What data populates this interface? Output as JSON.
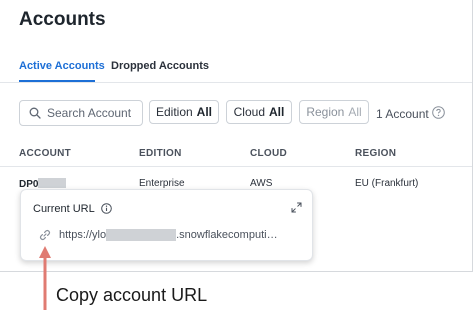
{
  "page": {
    "title": "Accounts"
  },
  "tabs": [
    {
      "label": "Active Accounts",
      "active": true
    },
    {
      "label": "Dropped Accounts",
      "active": false
    }
  ],
  "toolbar": {
    "search_placeholder": "Search Account",
    "filters": [
      {
        "label": "Edition",
        "value": "All",
        "enabled": true
      },
      {
        "label": "Cloud",
        "value": "All",
        "enabled": true
      },
      {
        "label": "Region",
        "value": "All",
        "enabled": false
      }
    ],
    "count": "1 Account"
  },
  "table": {
    "columns": [
      "ACCOUNT",
      "EDITION",
      "CLOUD",
      "REGION"
    ],
    "rows": [
      {
        "account": "DP0",
        "edition": "Enterprise",
        "cloud": "AWS",
        "region": "EU (Frankfurt)"
      }
    ]
  },
  "popover": {
    "title": "Current URL",
    "url_prefix": "https://ylo",
    "url_suffix": ".snowflakecomputi…"
  },
  "annotation": {
    "caption": "Copy account URL",
    "arrow_color": "#e07b72"
  },
  "colors": {
    "accent": "#1d6fd6"
  },
  "icons": [
    "search-icon",
    "help-icon",
    "info-icon",
    "expand-icon",
    "link-icon",
    "arrow-up-icon"
  ]
}
